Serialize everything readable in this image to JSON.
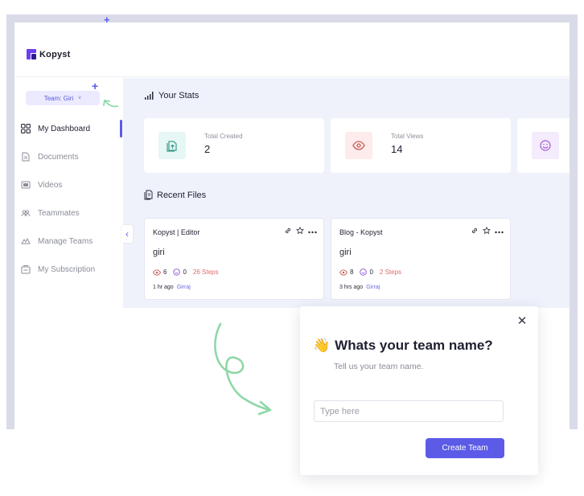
{
  "brand": {
    "name": "Kopyst",
    "accent": "#5b5be8"
  },
  "team": {
    "label": "Team: Giri",
    "chevron": "˅"
  },
  "sidebar": {
    "items": [
      {
        "label": "My Dashboard",
        "icon": "dashboard-icon",
        "active": true
      },
      {
        "label": "Documents",
        "icon": "document-icon"
      },
      {
        "label": "Videos",
        "icon": "video-icon"
      },
      {
        "label": "Teammates",
        "icon": "teammates-icon"
      },
      {
        "label": "Manage Teams",
        "icon": "manage-teams-icon"
      },
      {
        "label": "My Subscription",
        "icon": "subscription-icon"
      }
    ]
  },
  "stats": {
    "title": "Your Stats",
    "cards": [
      {
        "label": "Total Created",
        "value": "2",
        "icon": "document-upload-icon",
        "bg": "#e6f7f5"
      },
      {
        "label": "Total Views",
        "value": "14",
        "icon": "eye-icon",
        "bg": "#fdeceb"
      },
      {
        "label": "",
        "value": "",
        "icon": "smile-icon",
        "bg": "#f4ebfc"
      }
    ]
  },
  "recent": {
    "title": "Recent Files",
    "files": [
      {
        "name": "Kopyst | Editor",
        "author": "giri",
        "views": "6",
        "reactions": "0",
        "steps": "26 Steps",
        "time": "1 hr ago",
        "user": "Girraj"
      },
      {
        "name": "Blog - Kopyst",
        "author": "giri",
        "views": "8",
        "reactions": "0",
        "steps": "2 Steps",
        "time": "3 hrs ago",
        "user": "Girraj"
      }
    ]
  },
  "modal": {
    "emoji": "👋",
    "title": "Whats your team name?",
    "subtitle": "Tell us your team name.",
    "input_placeholder": "Type here",
    "input_value": "",
    "button": "Create Team",
    "close": "✕"
  }
}
